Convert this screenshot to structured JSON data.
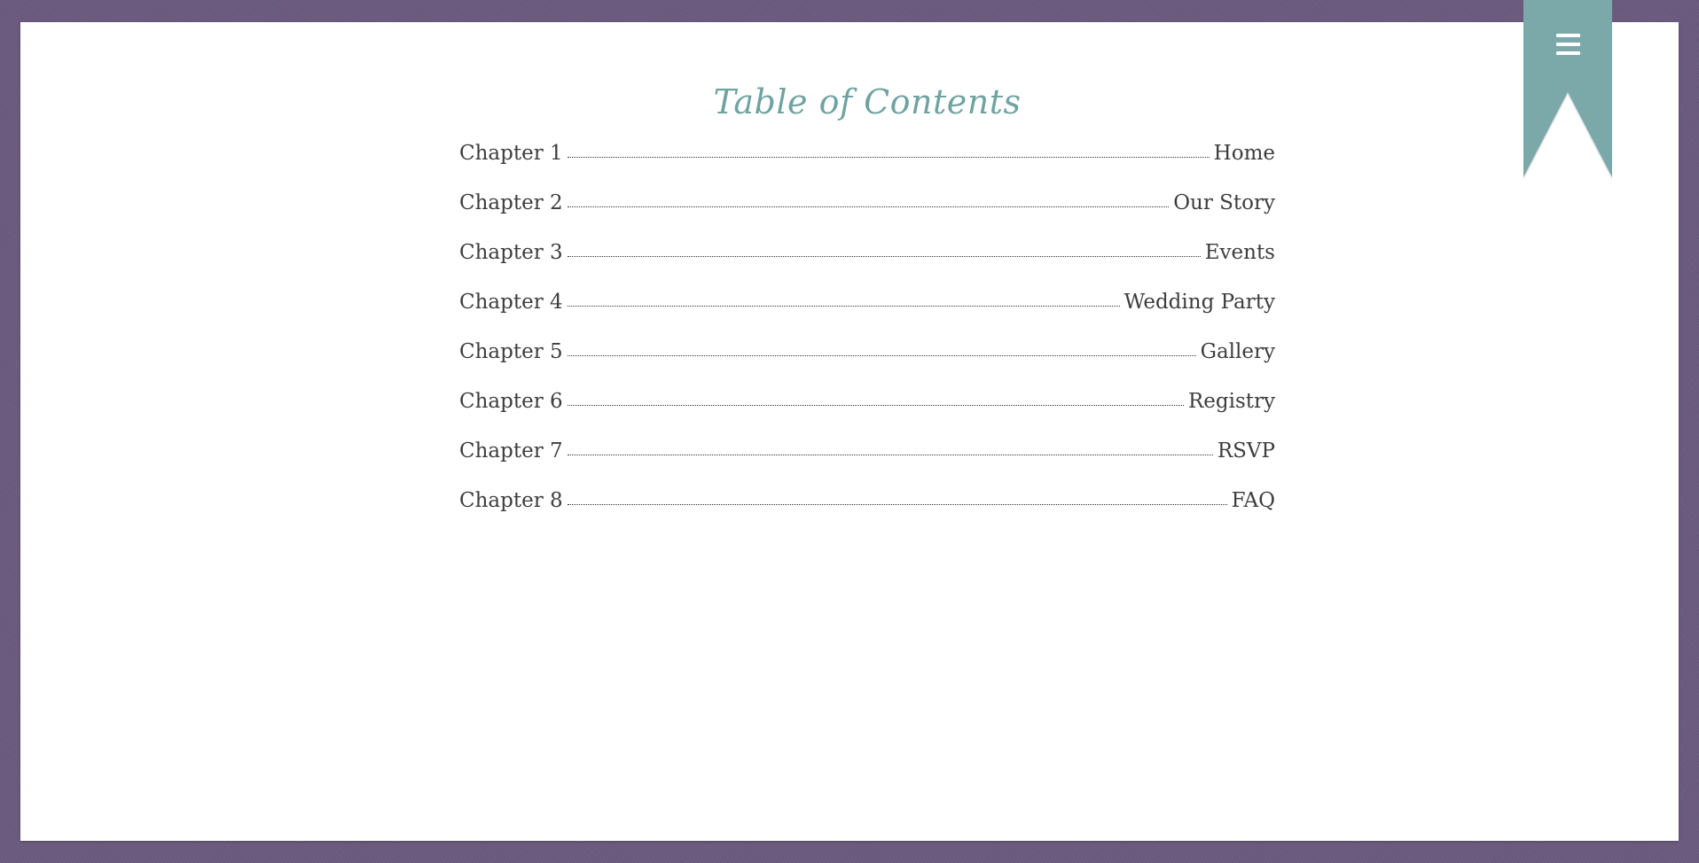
{
  "colors": {
    "frame_background": "#6b5a7e",
    "page_background": "#ffffff",
    "accent_teal": "#6fa3a1",
    "ribbon": "#7ba9aa",
    "text": "#3d3d3d"
  },
  "menu": {
    "icon": "hamburger-menu-icon"
  },
  "toc": {
    "title": "Table of Contents",
    "items": [
      {
        "chapter": "Chapter 1",
        "page": "Home"
      },
      {
        "chapter": "Chapter 2",
        "page": "Our Story"
      },
      {
        "chapter": "Chapter 3",
        "page": "Events"
      },
      {
        "chapter": "Chapter 4",
        "page": "Wedding Party"
      },
      {
        "chapter": "Chapter 5",
        "page": "Gallery"
      },
      {
        "chapter": "Chapter 6",
        "page": "Registry"
      },
      {
        "chapter": "Chapter 7",
        "page": "RSVP"
      },
      {
        "chapter": "Chapter 8",
        "page": "FAQ"
      }
    ]
  }
}
